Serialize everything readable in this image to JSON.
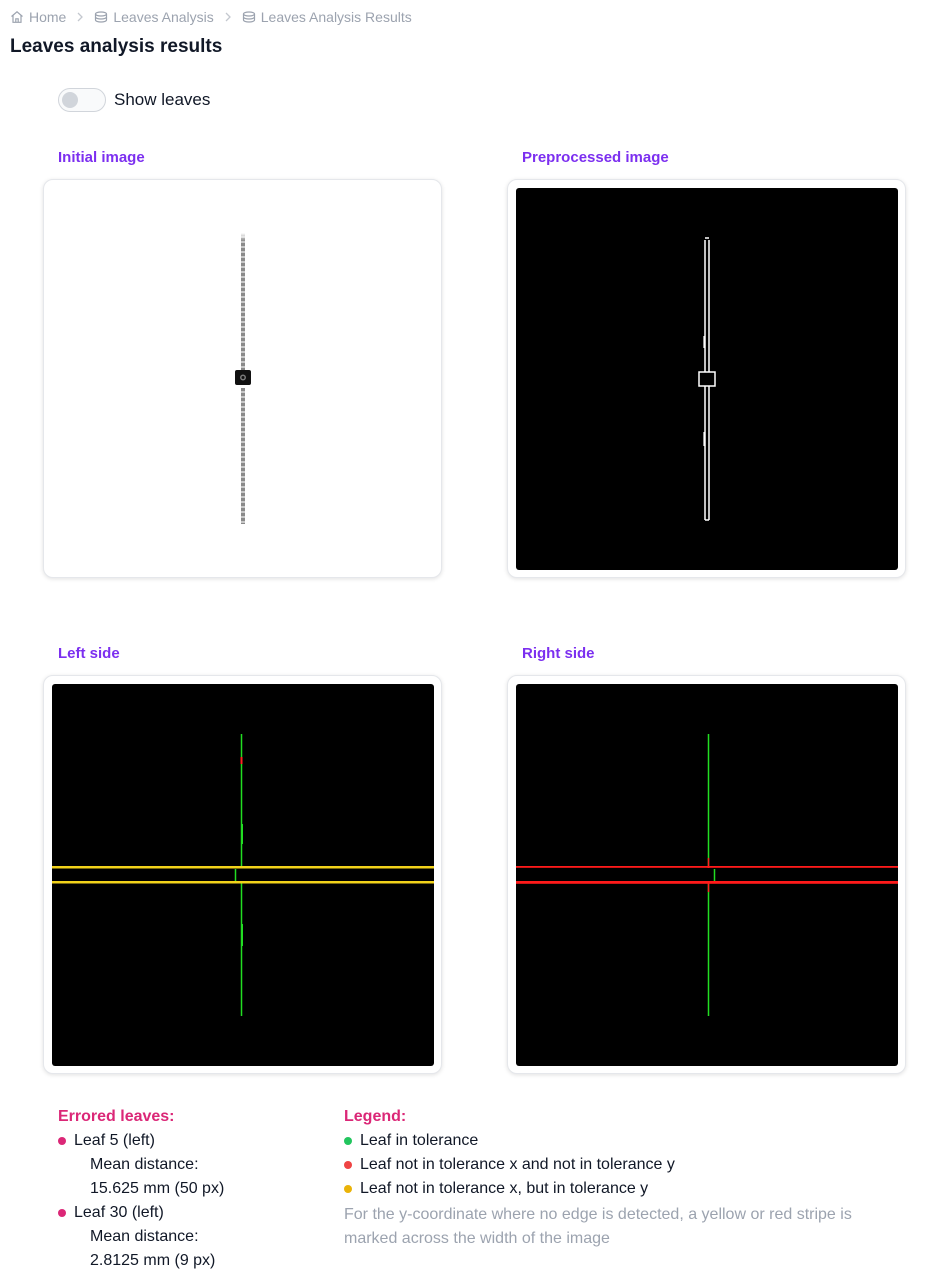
{
  "breadcrumb": [
    {
      "label": "Home",
      "icon": "home-icon"
    },
    {
      "label": "Leaves Analysis",
      "icon": "database-icon"
    },
    {
      "label": "Leaves Analysis Results",
      "icon": "database-icon"
    }
  ],
  "page_title": "Leaves analysis results",
  "toggle": {
    "label": "Show leaves",
    "checked": false
  },
  "panels": {
    "initial": {
      "title": "Initial image"
    },
    "preprocessed": {
      "title": "Preprocessed image"
    },
    "left": {
      "title": "Left side"
    },
    "right": {
      "title": "Right side"
    }
  },
  "errored": {
    "title": "Errored leaves:",
    "items": [
      {
        "name": "Leaf 5 (left)",
        "mean_label": "Mean distance:",
        "mean_value": "15.625 mm (50 px)"
      },
      {
        "name": "Leaf 30 (left)",
        "mean_label": "Mean distance:",
        "mean_value": "2.8125 mm (9 px)"
      }
    ]
  },
  "legend": {
    "title": "Legend:",
    "items": [
      {
        "label": "Leaf in tolerance",
        "color": "#22c55e"
      },
      {
        "label": "Leaf not in tolerance x and not in tolerance y",
        "color": "#ef4444"
      },
      {
        "label": "Leaf not in tolerance x, but in tolerance y",
        "color": "#eab308"
      }
    ],
    "note": "For the y-coordinate where no edge is detected, a yellow or red stripe is marked across the width of the image"
  },
  "colors": {
    "accent": "#7c2ff0",
    "pink": "#db2777",
    "muted": "#9ca3af",
    "tolerance_ok": "#22c55e",
    "tolerance_fail": "#ef4444",
    "tolerance_partial": "#eab308"
  }
}
